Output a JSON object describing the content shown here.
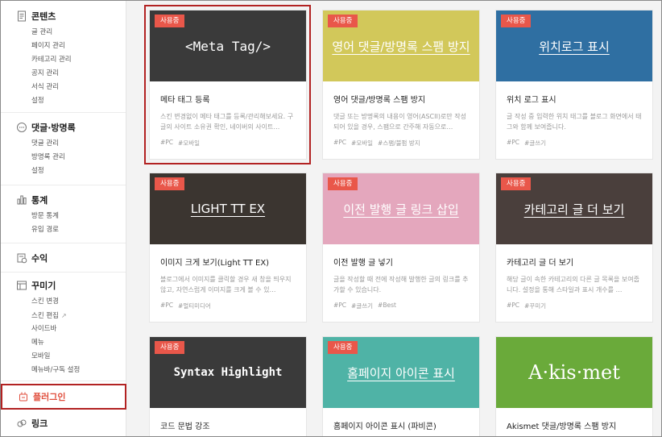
{
  "sidebar": {
    "sections": [
      {
        "title": "콘텐츠",
        "icon": "document-icon",
        "items": [
          "글 관리",
          "페이지 관리",
          "카테고리 관리",
          "공지 관리",
          "서식 관리",
          "설정"
        ]
      },
      {
        "title": "댓글·방명록",
        "icon": "comment-icon",
        "items": [
          "댓글 관리",
          "방명록 관리",
          "설정"
        ]
      },
      {
        "title": "통계",
        "icon": "bar-chart-icon",
        "items": [
          "방문 통계",
          "유입 경로"
        ]
      },
      {
        "title": "수익",
        "icon": "revenue-icon",
        "items": []
      },
      {
        "title": "꾸미기",
        "icon": "layout-icon",
        "items": [
          "스킨 변경",
          "스킨 편집",
          "사이드바",
          "메뉴",
          "모바일",
          "메뉴바/구독 설정"
        ]
      },
      {
        "title": "플러그인",
        "icon": "plugin-icon",
        "items": []
      },
      {
        "title": "링크",
        "icon": "link-icon",
        "items": []
      }
    ],
    "external_mark": "↗"
  },
  "colors": {
    "accent": "#e04e3c",
    "badge": "#e9574a",
    "highlight_border": "#b22222"
  },
  "cards": [
    {
      "badge": "사용중",
      "thumb_text": "<Meta Tag/>",
      "thumb_bg": "#3a3a3a",
      "title": "메타 태그 등록",
      "desc": "스킨 변경없이 메타 태그를 등록/관리해보세요. 구글의 사이트 소유권 확인, 네이버의 사이트…",
      "tags": [
        "#PC",
        "#모바일"
      ]
    },
    {
      "badge": "사용중",
      "thumb_text": "영어 댓글/방명록 스팸 방지",
      "thumb_bg": "#d2c85a",
      "title": "영어 댓글/방명록 스팸 방지",
      "desc": "댓글 또는 방명록의 내용이 영어(ASCII)로만 작성되어 있을 경우, 스팸으로 간주해 자동으로…",
      "tags": [
        "#PC",
        "#모바일",
        "#스팸/불펌 방지"
      ]
    },
    {
      "badge": "사용중",
      "thumb_text": "위치로그 표시",
      "thumb_bg": "#2f6fa2",
      "title": "위치 로그 표시",
      "desc": "글 작성 중 입력한 위치 태그를 블로그 화면에서 태그와 함께 보여줍니다.",
      "tags": [
        "#PC",
        "#글쓰기"
      ]
    },
    {
      "badge": "사용중",
      "thumb_text": "LIGHT TT EX",
      "thumb_bg": "#3b3530",
      "title": "이미지 크게 보기(Light TT EX)",
      "desc": "블로그에서 이미지를 클릭할 경우 새 창을 띄우지 않고, 자연스럽게 이미지를 크게 볼 수 있…",
      "tags": [
        "#PC",
        "#멀티미디어"
      ]
    },
    {
      "badge": "사용중",
      "thumb_text": "이전 발행 글 링크 삽입",
      "thumb_bg": "#e4a7bd",
      "title": "이전 발행 글 넣기",
      "desc": "글을 작성할 때 전에 작성해 발행한 글의 링크를 추가할 수 있습니다.",
      "tags": [
        "#PC",
        "#글쓰기",
        "#Best"
      ]
    },
    {
      "badge": "사용중",
      "thumb_text": "카테고리 글 더 보기",
      "thumb_bg": "#4a3f3c",
      "title": "카테고리 글 더 보기",
      "desc": "해당 글이 속한 카테고리의 다른 글 목록을 보여줍니다. 설정을 통해 스타일과 표시 개수를 …",
      "tags": [
        "#PC",
        "#꾸미기"
      ]
    },
    {
      "badge": "사용중",
      "thumb_text": "Syntax Highlight",
      "thumb_bg": "#3a3a3a",
      "title": "코드 문법 강조",
      "desc": "",
      "tags": []
    },
    {
      "badge": "사용중",
      "thumb_text": "홈페이지 아이콘 표시",
      "thumb_bg": "#4fb3a6",
      "title": "홈페이지 아이콘 표시 (파비콘)",
      "desc": "",
      "tags": []
    },
    {
      "badge": "",
      "thumb_text": "A·kis·met",
      "thumb_bg": "#6aaa3a",
      "title": "Akismet 댓글/방명록 스팸 방지",
      "desc": "",
      "tags": []
    }
  ]
}
